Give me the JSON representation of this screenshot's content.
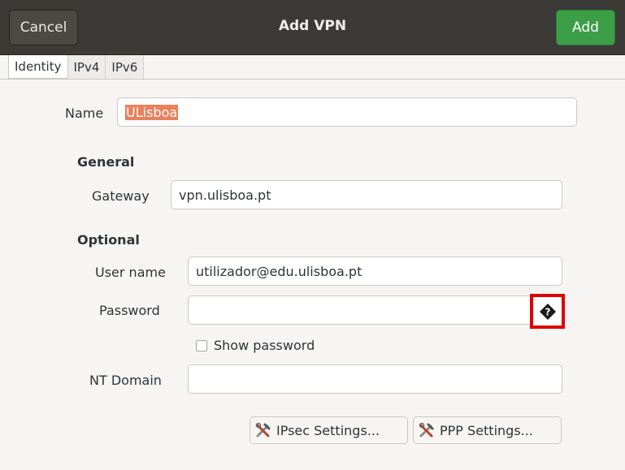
{
  "header": {
    "cancel_label": "Cancel",
    "title": "Add VPN",
    "add_label": "Add"
  },
  "tabs": [
    {
      "label": "Identity"
    },
    {
      "label": "IPv4"
    },
    {
      "label": "IPv6"
    }
  ],
  "identity": {
    "name_label": "Name",
    "name_value": "ULisboa",
    "general_title": "General",
    "gateway_label": "Gateway",
    "gateway_value": "vpn.ulisboa.pt",
    "optional_title": "Optional",
    "username_label": "User name",
    "username_value": "utilizador@edu.ulisboa.pt",
    "password_label": "Password",
    "password_value": "",
    "show_password_label": "Show password",
    "show_password_checked": false,
    "nt_domain_label": "NT Domain",
    "nt_domain_value": "",
    "ipsec_button": "IPsec Settings...",
    "ppp_button": "PPP Settings..."
  },
  "icons": {
    "password_options": "question-diamond-icon",
    "settings": "tools-icon"
  }
}
